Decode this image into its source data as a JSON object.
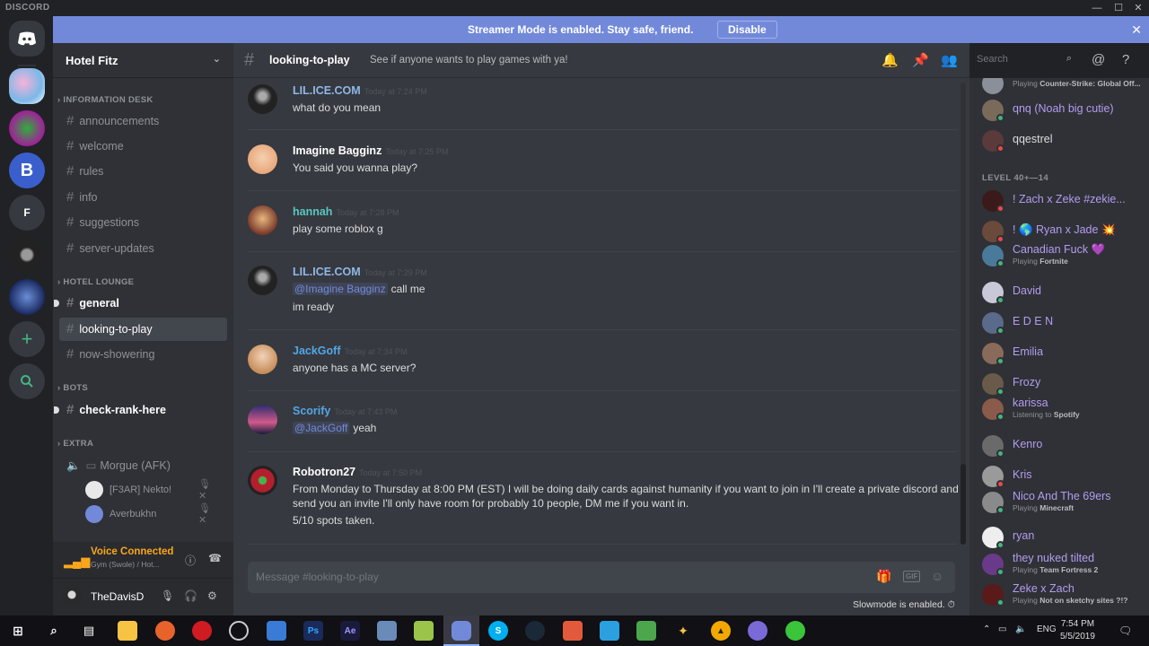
{
  "app": {
    "logo": "DISCORD"
  },
  "window_controls": {
    "minimize": "—",
    "maximize": "☐",
    "close": "✕"
  },
  "streamer": {
    "message": "Streamer Mode is enabled. Stay safe, friend.",
    "disable": "Disable",
    "close": "✕"
  },
  "server": {
    "name": "Hotel Fitz",
    "chevron": "⌄",
    "guild_letter": "F"
  },
  "categories": {
    "information_desk": "INFORMATION DESK",
    "hotel_lounge": "HOTEL LOUNGE",
    "bots": "BOTS",
    "extra": "EXTRA"
  },
  "channels": {
    "hash": "#",
    "announcements": "announcements",
    "welcome": "welcome",
    "rules": "rules",
    "info": "info",
    "suggestions": "suggestions",
    "server_updates": "server-updates",
    "general": "general",
    "looking_to_play": "looking-to-play",
    "now_showering": "now-showering",
    "check_rank_here": "check-rank-here",
    "morgue": "Morgue (AFK)"
  },
  "voice_users": [
    {
      "name": "[F3AR] Nekto!"
    },
    {
      "name": "Averbukhn"
    }
  ],
  "voice": {
    "status": "Voice Connected",
    "sub": "Gym (Swole) / Hot..."
  },
  "user": {
    "name": "TheDavisD"
  },
  "chat_header": {
    "channel": "looking-to-play",
    "topic": "See if anyone wants to play games with ya!",
    "search_placeholder": "Search"
  },
  "messages": [
    {
      "user": "LIL.ICE.COM",
      "time": "Today at 7:24 PM",
      "lines": [
        "what do you mean"
      ]
    },
    {
      "user": "Imagine Bagginz",
      "time": "Today at 7:25 PM",
      "lines": [
        "You said you wanna play?"
      ]
    },
    {
      "user": "hannah",
      "time": "Today at 7:28 PM",
      "lines": [
        "play some roblox g"
      ]
    },
    {
      "user": "LIL.ICE.COM",
      "time": "Today at 7:29 PM",
      "mention": "@Imagine Bagginz",
      "lines": [
        "call me",
        "im ready"
      ]
    },
    {
      "user": "JackGoff",
      "time": "Today at 7:34 PM",
      "lines": [
        "anyone has a MC server?"
      ]
    },
    {
      "user": "Scorify",
      "time": "Today at 7:43 PM",
      "mention": "@JackGoff",
      "lines": [
        "yeah"
      ]
    },
    {
      "user": "Robotron27",
      "time": "Today at 7:50 PM",
      "lines": [
        "From Monday to Thursday at 8:00 PM (EST) I will be doing daily cards against humanity if you want to join in I'll create a private discord and",
        "send you an invite I'll only have room for probably 10 people, DM me if you want in.",
        "5/10 spots taken."
      ]
    }
  ],
  "composer": {
    "placeholder": "Message #looking-to-play",
    "gif": "GIF"
  },
  "slowmode": "Slowmode is enabled.",
  "members": {
    "top_playing_prefix": "Playing ",
    "top_playing_game": "Counter-Strike: Global Off...",
    "pre": [
      {
        "name": "qnq (Noah big cutie)"
      },
      {
        "name": "qqestrel"
      }
    ],
    "category": "LEVEL 40+—14",
    "list": [
      {
        "name": "! Zach x Zeke #zekie...",
        "status": "",
        "game": ""
      },
      {
        "name": "! 🌎 Ryan x Jade 💥",
        "status": "",
        "game": ""
      },
      {
        "name": "Canadian Fuck 💜",
        "status": "Playing ",
        "game": "Fortnite"
      },
      {
        "name": "David",
        "status": "",
        "game": ""
      },
      {
        "name": "E D E N",
        "status": "",
        "game": ""
      },
      {
        "name": "Emilia",
        "status": "",
        "game": ""
      },
      {
        "name": "Frozy",
        "status": "",
        "game": ""
      },
      {
        "name": "karissa",
        "status": "Listening to ",
        "game": "Spotify"
      },
      {
        "name": "Kenro",
        "status": "",
        "game": ""
      },
      {
        "name": "Kris",
        "status": "",
        "game": ""
      },
      {
        "name": "Nico And The 69ers",
        "status": "Playing ",
        "game": "Minecraft"
      },
      {
        "name": "ryan",
        "status": "",
        "game": ""
      },
      {
        "name": "they nuked tilted",
        "status": "Playing ",
        "game": "Team Fortress 2"
      },
      {
        "name": "Zeke x Zach",
        "status": "Playing ",
        "game": "Not on sketchy sites ?!?"
      }
    ]
  },
  "taskbar": {
    "lang": "ENG",
    "time": "7:54 PM",
    "date": "5/5/2019"
  },
  "colors": {
    "accent": "#7289da",
    "online": "#43b581",
    "idle": "#faa61a",
    "dnd": "#f04747"
  }
}
